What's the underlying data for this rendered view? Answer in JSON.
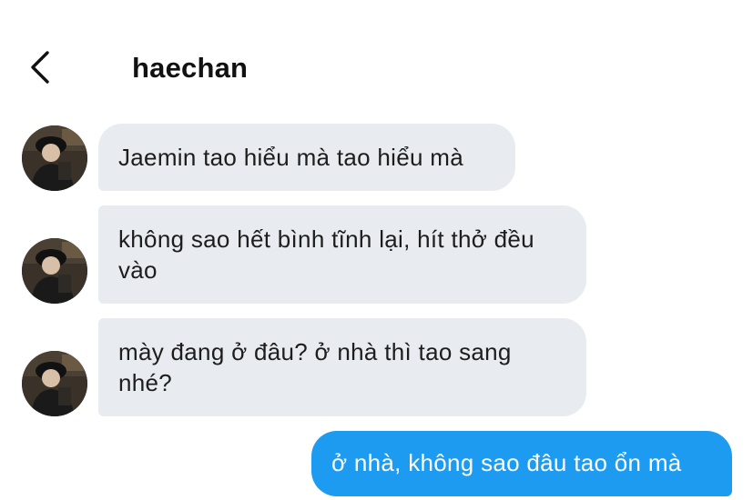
{
  "header": {
    "back_icon": "chevron-left-icon",
    "contact_name": "haechan"
  },
  "messages": [
    {
      "direction": "incoming",
      "text": "Jaemin tao hiểu mà tao hiểu mà"
    },
    {
      "direction": "incoming",
      "text": "không sao hết bình tĩnh lại, hít thở đều vào"
    },
    {
      "direction": "incoming",
      "text": "mày đang ở đâu? ở nhà thì tao sang nhé?"
    },
    {
      "direction": "outgoing",
      "text": "ở nhà, không sao đâu tao ổn mà"
    }
  ],
  "colors": {
    "incoming_bubble": "#e8ebef",
    "outgoing_bubble": "#1d9bf0",
    "background": "#ffffff"
  }
}
